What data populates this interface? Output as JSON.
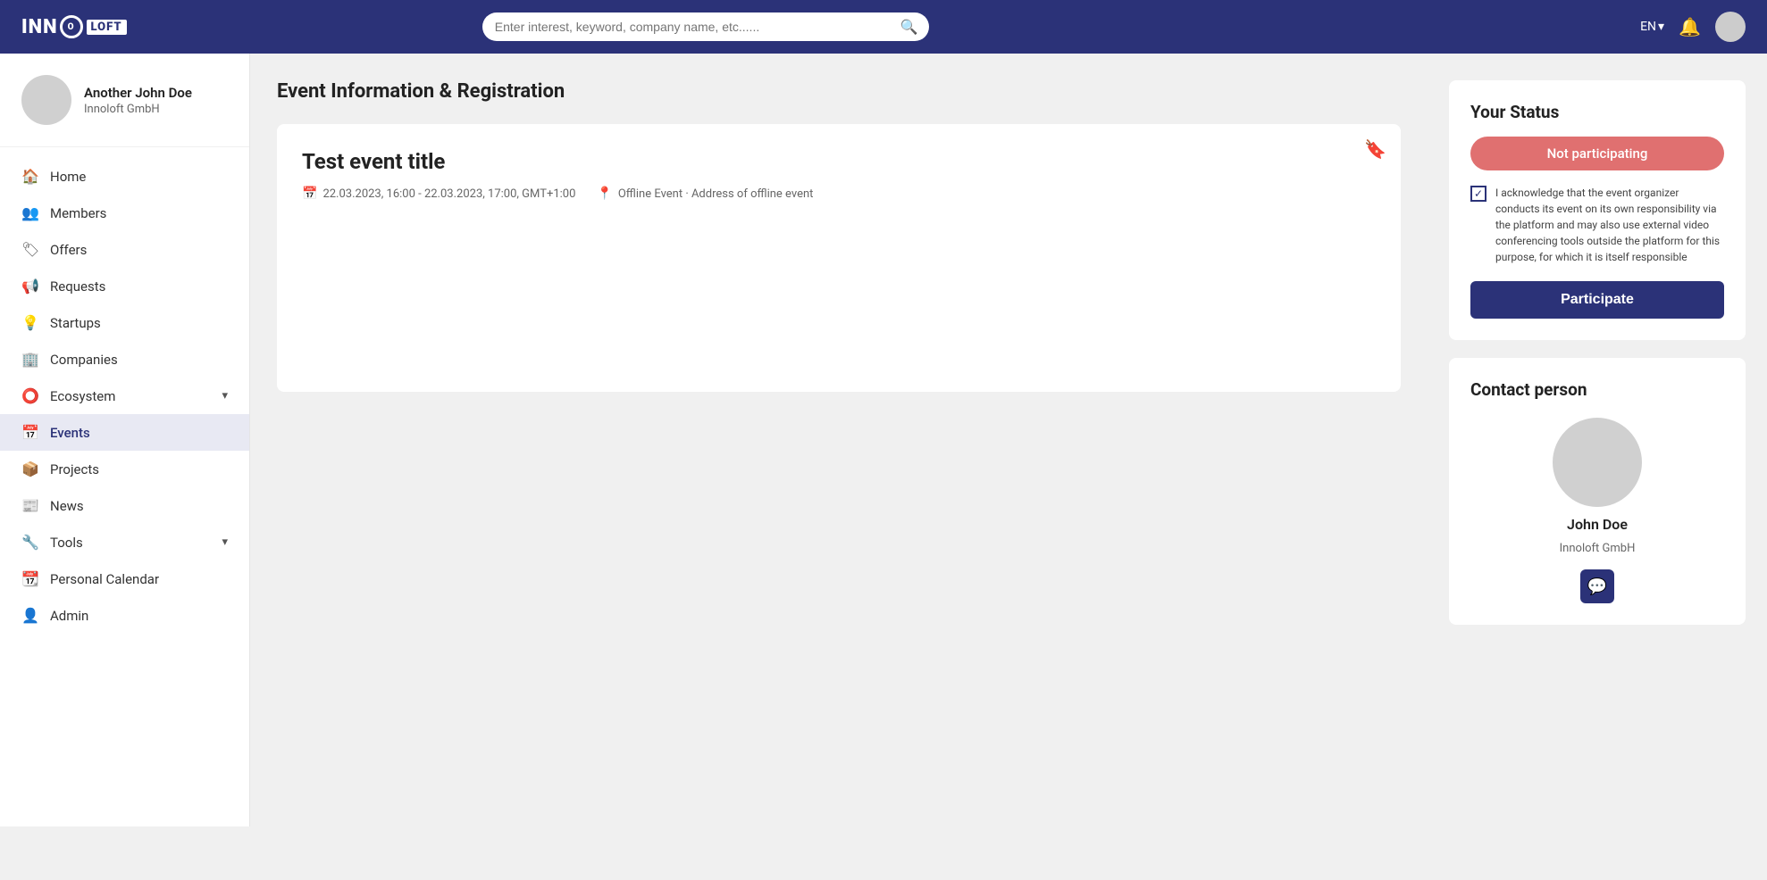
{
  "app": {
    "logo_inno": "INN",
    "logo_o": "O",
    "logo_loft": "LOFT"
  },
  "topnav": {
    "search_placeholder": "Enter interest, keyword, company name, etc......",
    "lang": "EN",
    "lang_chevron": "▾"
  },
  "sidebar": {
    "profile": {
      "name": "Another John Doe",
      "company": "Innoloft GmbH"
    },
    "items": [
      {
        "id": "home",
        "label": "Home",
        "icon": "🏠"
      },
      {
        "id": "members",
        "label": "Members",
        "icon": "👥"
      },
      {
        "id": "offers",
        "label": "Offers",
        "icon": "🏷"
      },
      {
        "id": "requests",
        "label": "Requests",
        "icon": "📢"
      },
      {
        "id": "startups",
        "label": "Startups",
        "icon": "💡"
      },
      {
        "id": "companies",
        "label": "Companies",
        "icon": "🏢"
      },
      {
        "id": "ecosystem",
        "label": "Ecosystem",
        "icon": "⭕",
        "has_chevron": true
      },
      {
        "id": "events",
        "label": "Events",
        "icon": "📅",
        "active": true
      },
      {
        "id": "projects",
        "label": "Projects",
        "icon": "📦"
      },
      {
        "id": "news",
        "label": "News",
        "icon": "📰"
      },
      {
        "id": "tools",
        "label": "Tools",
        "icon": "🔧",
        "has_chevron": true
      },
      {
        "id": "personal-calendar",
        "label": "Personal Calendar",
        "icon": "📆"
      },
      {
        "id": "admin",
        "label": "Admin",
        "icon": "👤"
      }
    ]
  },
  "page": {
    "title": "Event Information & Registration"
  },
  "event": {
    "title": "Test event title",
    "date": "22.03.2023, 16:00 - 22.03.2023, 17:00, GMT+1:00",
    "location": "Offline Event · Address of offline event"
  },
  "status": {
    "title": "Your Status",
    "badge": "Not participating",
    "acknowledge_text": "I acknowledge that the event organizer conducts its event on its own responsibility via the platform and may also use external video conferencing tools outside the platform for this purpose, for which it is itself responsible",
    "participate_btn": "Participate"
  },
  "contact": {
    "title": "Contact person",
    "name": "John Doe",
    "company": "Innoloft GmbH",
    "msg_icon": "💬"
  }
}
